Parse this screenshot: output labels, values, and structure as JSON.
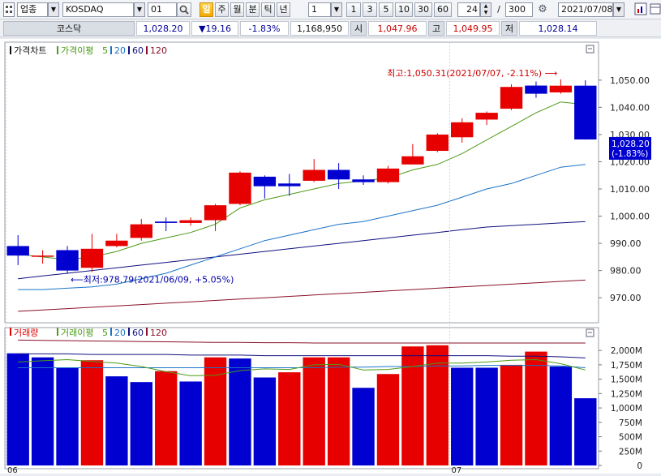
{
  "toolbar": {
    "market_type": "업종",
    "index_name": "KOSDAQ",
    "code": "01",
    "period_buttons": [
      "일",
      "주",
      "월",
      "분",
      "틱",
      "년"
    ],
    "active_period": "일",
    "interval_value": "1",
    "interval_buttons": [
      "1",
      "3",
      "5",
      "10",
      "30",
      "60"
    ],
    "count_value": "24",
    "count_separator": "/",
    "total_value": "300",
    "date_value": "2021/07/08"
  },
  "quote": {
    "name": "코스닥",
    "price": "1,028.20",
    "change": "▼19.16",
    "change_pct": "-1.83%",
    "volume": "1,168,950",
    "open_label": "시",
    "open": "1,047.96",
    "high_label": "고",
    "high": "1,049.95",
    "low_label": "저",
    "low": "1,028.14"
  },
  "colors": {
    "up": "#e60000",
    "down": "#0000d0",
    "ma5": "#4c9a16",
    "ma20": "#1b73c8",
    "ma60": "#101080",
    "ma120": "#8a1028"
  },
  "chart_data": [
    {
      "type": "candlestick",
      "panel_title": "가격차트",
      "legend": [
        {
          "label": "가격이평",
          "color": "#4c9a16"
        },
        {
          "label": "5",
          "color": "#4c9a16"
        },
        {
          "label": "20",
          "color": "#1b73c8"
        },
        {
          "label": "60",
          "color": "#101080"
        },
        {
          "label": "120",
          "color": "#8a1028"
        }
      ],
      "x_labels": [
        {
          "label": "06",
          "index": 0
        },
        {
          "label": "07",
          "index": 18
        }
      ],
      "ylim": [
        962,
        1058
      ],
      "y_ticks": [
        "970.00",
        "980.00",
        "990.00",
        "1,000.00",
        "1,010.00",
        "1,020.00",
        "1,030.00",
        "1,040.00",
        "1,050.00"
      ],
      "y_tick_values": [
        970,
        980,
        990,
        1000,
        1010,
        1020,
        1030,
        1040,
        1050
      ],
      "candles": [
        {
          "o": 989.0,
          "h": 993.0,
          "l": 982.0,
          "c": 985.5
        },
        {
          "o": 985.5,
          "h": 987.5,
          "l": 982.5,
          "c": 985.5
        },
        {
          "o": 987.5,
          "h": 989.0,
          "l": 978.8,
          "c": 980.0
        },
        {
          "o": 981.0,
          "h": 993.5,
          "l": 979.5,
          "c": 988.0
        },
        {
          "o": 989.0,
          "h": 993.5,
          "l": 988.5,
          "c": 991.0
        },
        {
          "o": 992.0,
          "h": 999.0,
          "l": 991.0,
          "c": 997.0
        },
        {
          "o": 998.0,
          "h": 999.5,
          "l": 994.5,
          "c": 997.5
        },
        {
          "o": 997.5,
          "h": 999.5,
          "l": 996.5,
          "c": 998.5
        },
        {
          "o": 998.5,
          "h": 1004.5,
          "l": 994.5,
          "c": 1004.0
        },
        {
          "o": 1004.5,
          "h": 1016.5,
          "l": 1004.0,
          "c": 1016.0
        },
        {
          "o": 1014.5,
          "h": 1015.0,
          "l": 1006.5,
          "c": 1011.0
        },
        {
          "o": 1012.0,
          "h": 1015.5,
          "l": 1007.5,
          "c": 1011.0
        },
        {
          "o": 1013.0,
          "h": 1021.0,
          "l": 1012.5,
          "c": 1017.0
        },
        {
          "o": 1017.0,
          "h": 1019.5,
          "l": 1010.0,
          "c": 1013.5
        },
        {
          "o": 1013.5,
          "h": 1015.0,
          "l": 1011.5,
          "c": 1012.5
        },
        {
          "o": 1012.5,
          "h": 1018.5,
          "l": 1012.0,
          "c": 1017.5
        },
        {
          "o": 1019.0,
          "h": 1026.5,
          "l": 1019.0,
          "c": 1022.0
        },
        {
          "o": 1024.0,
          "h": 1030.5,
          "l": 1023.5,
          "c": 1030.0
        },
        {
          "o": 1029.0,
          "h": 1036.0,
          "l": 1027.0,
          "c": 1034.5
        },
        {
          "o": 1035.5,
          "h": 1038.5,
          "l": 1033.5,
          "c": 1038.0
        },
        {
          "o": 1039.5,
          "h": 1048.5,
          "l": 1039.0,
          "c": 1047.5
        },
        {
          "o": 1048.0,
          "h": 1049.5,
          "l": 1043.5,
          "c": 1045.0
        },
        {
          "o": 1045.5,
          "h": 1050.31,
          "l": 1045.0,
          "c": 1047.96
        },
        {
          "o": 1047.96,
          "h": 1049.95,
          "l": 1028.14,
          "c": 1028.2
        }
      ],
      "ma5": [
        986,
        985,
        984,
        985,
        987,
        990,
        992,
        994,
        997,
        1003,
        1006,
        1008,
        1010,
        1012,
        1013,
        1014,
        1017,
        1019,
        1023,
        1028,
        1033,
        1038,
        1042,
        1041
      ],
      "ma20": [
        973,
        973,
        973.5,
        974,
        975,
        977,
        979,
        982,
        985,
        988,
        991,
        993,
        995,
        997,
        998,
        1000,
        1002,
        1004,
        1007,
        1010,
        1012,
        1015,
        1018,
        1019
      ],
      "ma60": [
        977,
        978,
        979,
        980,
        981,
        982,
        983,
        984,
        985,
        986,
        987,
        988,
        989,
        990,
        991,
        992,
        993,
        994,
        995,
        996,
        996.5,
        997,
        997.5,
        998
      ],
      "ma120": [
        965,
        965.5,
        966,
        966.5,
        967,
        967.5,
        968,
        968.5,
        969,
        969.5,
        970,
        970.5,
        971,
        971.5,
        972,
        972.5,
        973,
        973.5,
        974,
        974.5,
        975,
        975.5,
        976,
        976.5
      ],
      "annotations": {
        "max": {
          "text": "최고:1,050.31(2021/07/07, -2.11%)",
          "arrow": "⟶",
          "index": 22
        },
        "min": {
          "text": "최저:978.79(2021/06/09, +5.05%)",
          "arrow": "⟵",
          "index": 2
        }
      },
      "last_price_labels": [
        "1,028.20",
        "(-1.83%)"
      ]
    },
    {
      "type": "bar",
      "panel_title": "거래량",
      "legend": [
        {
          "label": "거래이평",
          "color": "#4c9a16"
        },
        {
          "label": "5",
          "color": "#4c9a16"
        },
        {
          "label": "20",
          "color": "#1b73c8"
        },
        {
          "label": "60",
          "color": "#101080"
        },
        {
          "label": "120",
          "color": "#8a1028"
        }
      ],
      "ylim": [
        0,
        2200
      ],
      "y_ticks": [
        "0",
        "250M",
        "500M",
        "750M",
        "1,000M",
        "1,250M",
        "1,500M",
        "1,750M",
        "2,000M"
      ],
      "y_tick_values": [
        0,
        250,
        500,
        750,
        1000,
        1250,
        1500,
        1750,
        2000
      ],
      "values": [
        1950,
        1880,
        1700,
        1830,
        1550,
        1450,
        1640,
        1460,
        1880,
        1860,
        1530,
        1620,
        1880,
        1880,
        1350,
        1590,
        2070,
        2090,
        1700,
        1700,
        1750,
        1980,
        1720,
        1168.95
      ],
      "up": [
        false,
        false,
        false,
        true,
        false,
        false,
        true,
        false,
        true,
        false,
        false,
        true,
        true,
        true,
        false,
        true,
        true,
        true,
        false,
        false,
        true,
        true,
        false,
        false
      ],
      "ma5": [
        1800,
        1820,
        1840,
        1810,
        1780,
        1720,
        1630,
        1560,
        1570,
        1650,
        1680,
        1670,
        1750,
        1760,
        1660,
        1670,
        1720,
        1780,
        1780,
        1800,
        1830,
        1840,
        1770,
        1660
      ],
      "ma20": [
        1700,
        1700,
        1700,
        1700,
        1700,
        1700,
        1700,
        1700,
        1700,
        1700,
        1700,
        1700,
        1700,
        1710,
        1710,
        1720,
        1720,
        1730,
        1730,
        1740,
        1740,
        1740,
        1730,
        1700
      ],
      "ma60": [
        1940,
        1940,
        1940,
        1930,
        1930,
        1930,
        1930,
        1920,
        1920,
        1920,
        1910,
        1910,
        1910,
        1910,
        1910,
        1910,
        1910,
        1910,
        1910,
        1910,
        1900,
        1900,
        1890,
        1870
      ],
      "ma120": [
        2180,
        2175,
        2170,
        2165,
        2160,
        2155,
        2150,
        2145,
        2140,
        2140,
        2135,
        2135,
        2130,
        2130,
        2130,
        2130,
        2130,
        2130,
        2130,
        2130,
        2130,
        2130,
        2130,
        2130
      ]
    }
  ]
}
